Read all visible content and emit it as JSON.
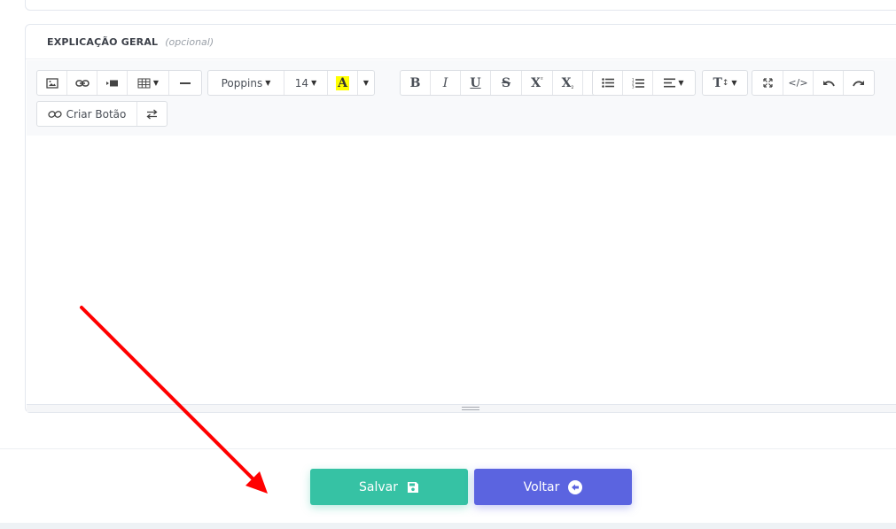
{
  "section": {
    "title": "EXPLICAÇÃO GERAL",
    "optional": "(opcional)"
  },
  "toolbar": {
    "font_family": "Poppins",
    "font_size": "14",
    "highlight_letter": "A",
    "bold": "B",
    "italic": "I",
    "underline": "U",
    "strike": "S",
    "superscript": "X",
    "subscript": "X",
    "text_height": "T",
    "code_view": "</>",
    "criar_botao": "Criar Botão"
  },
  "editor": {
    "content": ""
  },
  "actions": {
    "save_label": "Salvar",
    "back_label": "Voltar"
  },
  "colors": {
    "save": "#36c2a4",
    "back": "#5b64e0",
    "highlight": "#ffff00",
    "arrow": "#ff0000"
  },
  "icons": {
    "picture": "picture-icon",
    "link": "link-icon",
    "video": "video-icon",
    "table": "table-icon",
    "hr": "horizontal-rule-icon",
    "eraser": "eraser-icon",
    "ul": "unordered-list-icon",
    "ol": "ordered-list-icon",
    "align": "align-icon",
    "fullscreen": "fullscreen-icon",
    "undo": "undo-icon",
    "redo": "redo-icon",
    "swap": "swap-icon",
    "save": "floppy-disk-icon",
    "back": "arrow-left-circle-icon"
  }
}
